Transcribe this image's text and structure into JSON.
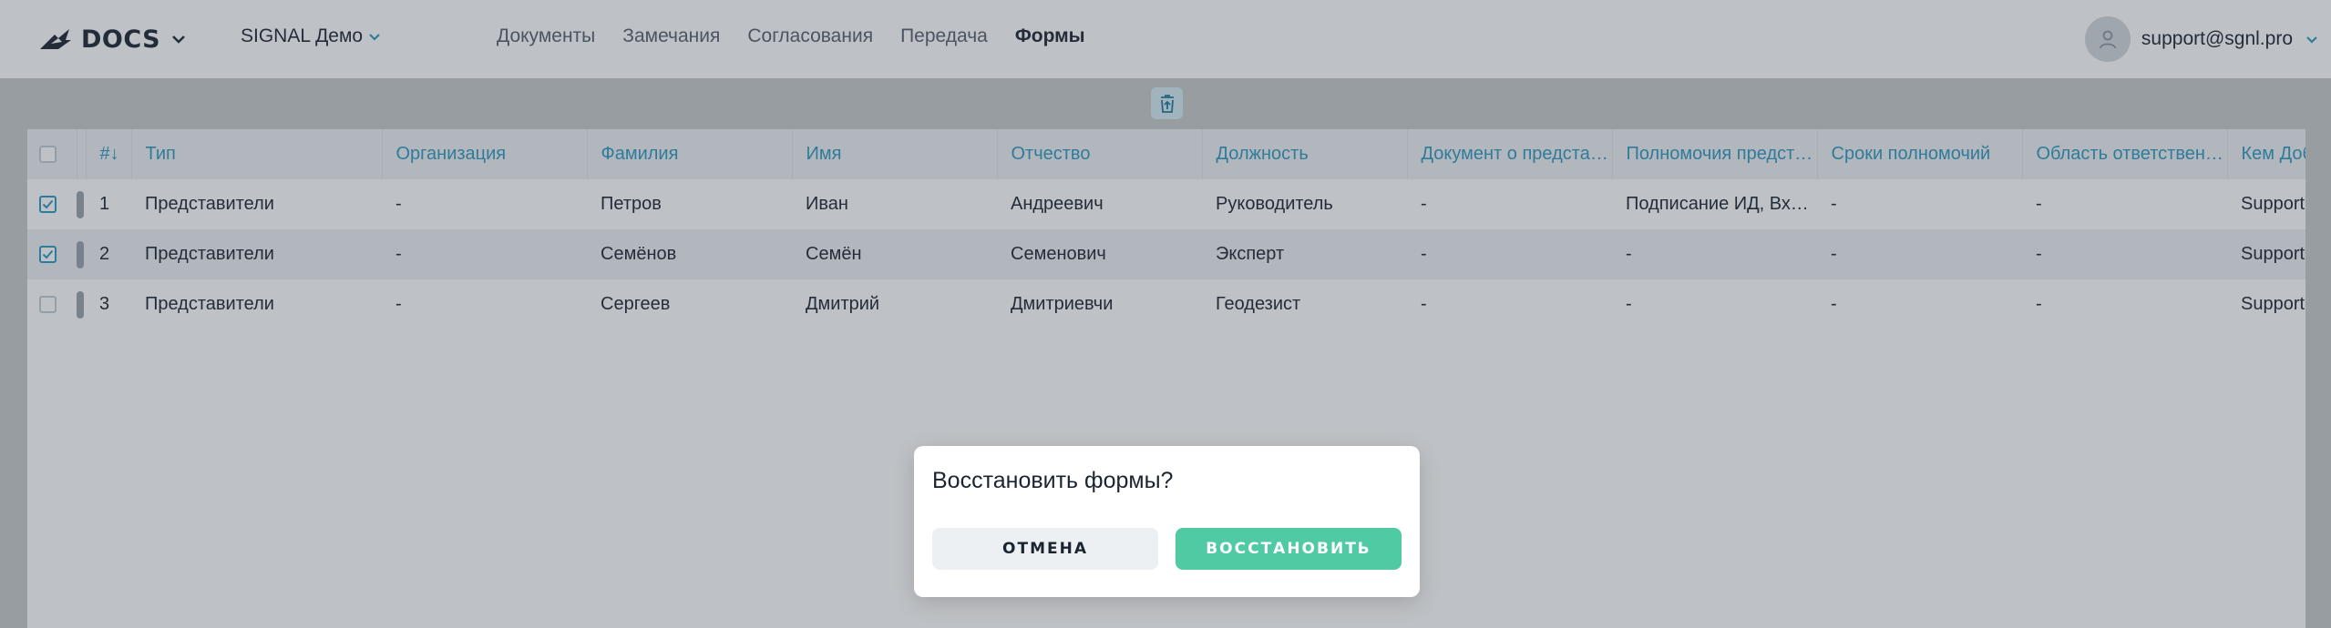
{
  "header": {
    "logo_text": "DOCS",
    "project": "SIGNAL Демо",
    "nav": [
      {
        "label": "Документы",
        "active": false
      },
      {
        "label": "Замечания",
        "active": false
      },
      {
        "label": "Согласования",
        "active": false
      },
      {
        "label": "Передача",
        "active": false
      },
      {
        "label": "Формы",
        "active": true
      }
    ],
    "user_email": "support@sgnl.pro"
  },
  "table": {
    "columns": [
      "#↓",
      "Тип",
      "Организация",
      "Фамилия",
      "Имя",
      "Отчество",
      "Должность",
      "Документ о представителе",
      "Полномочия представителя",
      "Сроки полномочий",
      "Область ответственности",
      "Кем Добавлено"
    ],
    "rows": [
      {
        "checked": true,
        "cells": [
          "1",
          "Представители",
          "-",
          "Петров",
          "Иван",
          "Андреевич",
          "Руководитель",
          "-",
          "Подписание ИД, Входной контроль",
          "-",
          "-",
          "Support"
        ]
      },
      {
        "checked": true,
        "cells": [
          "2",
          "Представители",
          "-",
          "Семёнов",
          "Семён",
          "Семенович",
          "Эксперт",
          "-",
          "-",
          "-",
          "-",
          "Support"
        ]
      },
      {
        "checked": false,
        "cells": [
          "3",
          "Представители",
          "-",
          "Сергеев",
          "Дмитрий",
          "Дмитриевчи",
          "Геодезист",
          "-",
          "-",
          "-",
          "-",
          "Support"
        ]
      }
    ]
  },
  "dialog": {
    "title": "Восстановить формы?",
    "cancel_label": "ОТМЕНА",
    "confirm_label": "ВОССТАНОВИТЬ"
  },
  "colors": {
    "accent": "#2c98c2",
    "confirm": "#4fcaa3",
    "text": "#1b2430"
  }
}
